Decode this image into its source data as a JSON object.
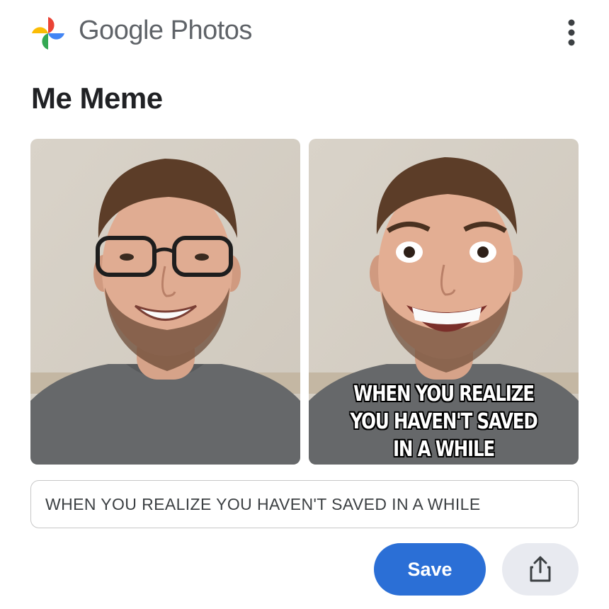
{
  "app": {
    "name": "Google Photos"
  },
  "page": {
    "title": "Me Meme"
  },
  "editor": {
    "caption_overlay": "WHEN YOU REALIZE YOU HAVEN'T SAVED IN A WHILE",
    "caption_value": "WHEN YOU REALIZE YOU HAVEN'T SAVED IN A WHILE"
  },
  "actions": {
    "save_label": "Save"
  },
  "icons": {
    "menu": "more-vert-icon",
    "share": "share-icon",
    "logo": "google-photos-pinwheel"
  },
  "colors": {
    "save_button": "#2b6fd6",
    "share_button": "#e8eaf0",
    "logo_red": "#ea4335",
    "logo_yellow": "#fbbc04",
    "logo_green": "#34a853",
    "logo_blue": "#4285f4"
  }
}
